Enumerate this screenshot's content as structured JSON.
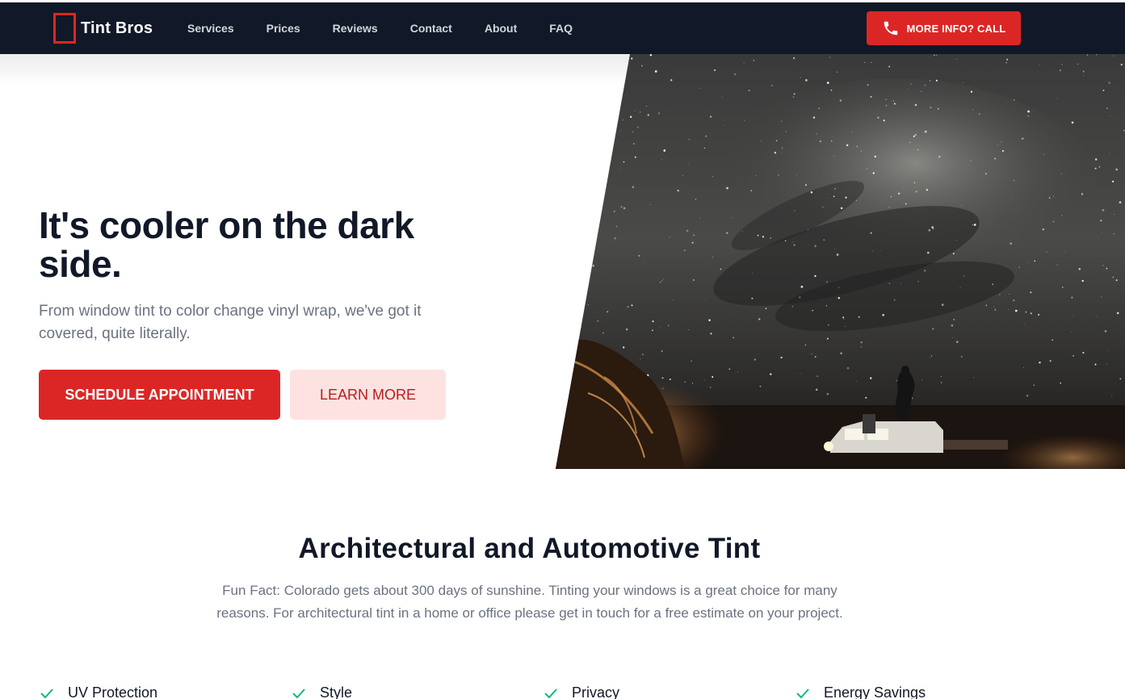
{
  "brand": {
    "name": "Tint Bros",
    "accent": "#dc2626",
    "nav_bg": "#111827"
  },
  "nav": {
    "links": [
      "Services",
      "Prices",
      "Reviews",
      "Contact",
      "About",
      "FAQ"
    ],
    "call_label": "MORE INFO? CALL",
    "call_icon": "phone-icon"
  },
  "hero": {
    "title": "It's cooler on the dark side.",
    "subtitle": "From window tint to color change vinyl wrap, we've got it covered, quite literally.",
    "primary_label": "SCHEDULE APPOINTMENT",
    "secondary_label": "LEARN MORE",
    "image": "night-sky-truck-photo"
  },
  "section": {
    "title": "Architectural and Automotive Tint",
    "subtitle": "Fun Fact: Colorado gets about 300 days of sunshine. Tinting your windows is a great choice for many reasons. For architectural tint in a home or office please get in touch for a free estimate on your project."
  },
  "features": [
    {
      "label": "UV Protection",
      "icon": "check-icon"
    },
    {
      "label": "Style",
      "icon": "check-icon"
    },
    {
      "label": "Privacy",
      "icon": "check-icon"
    },
    {
      "label": "Energy Savings",
      "icon": "check-icon"
    }
  ],
  "colors": {
    "check": "#10b981",
    "muted_text": "#6b7280",
    "secondary_btn_bg": "#fee2e2"
  }
}
